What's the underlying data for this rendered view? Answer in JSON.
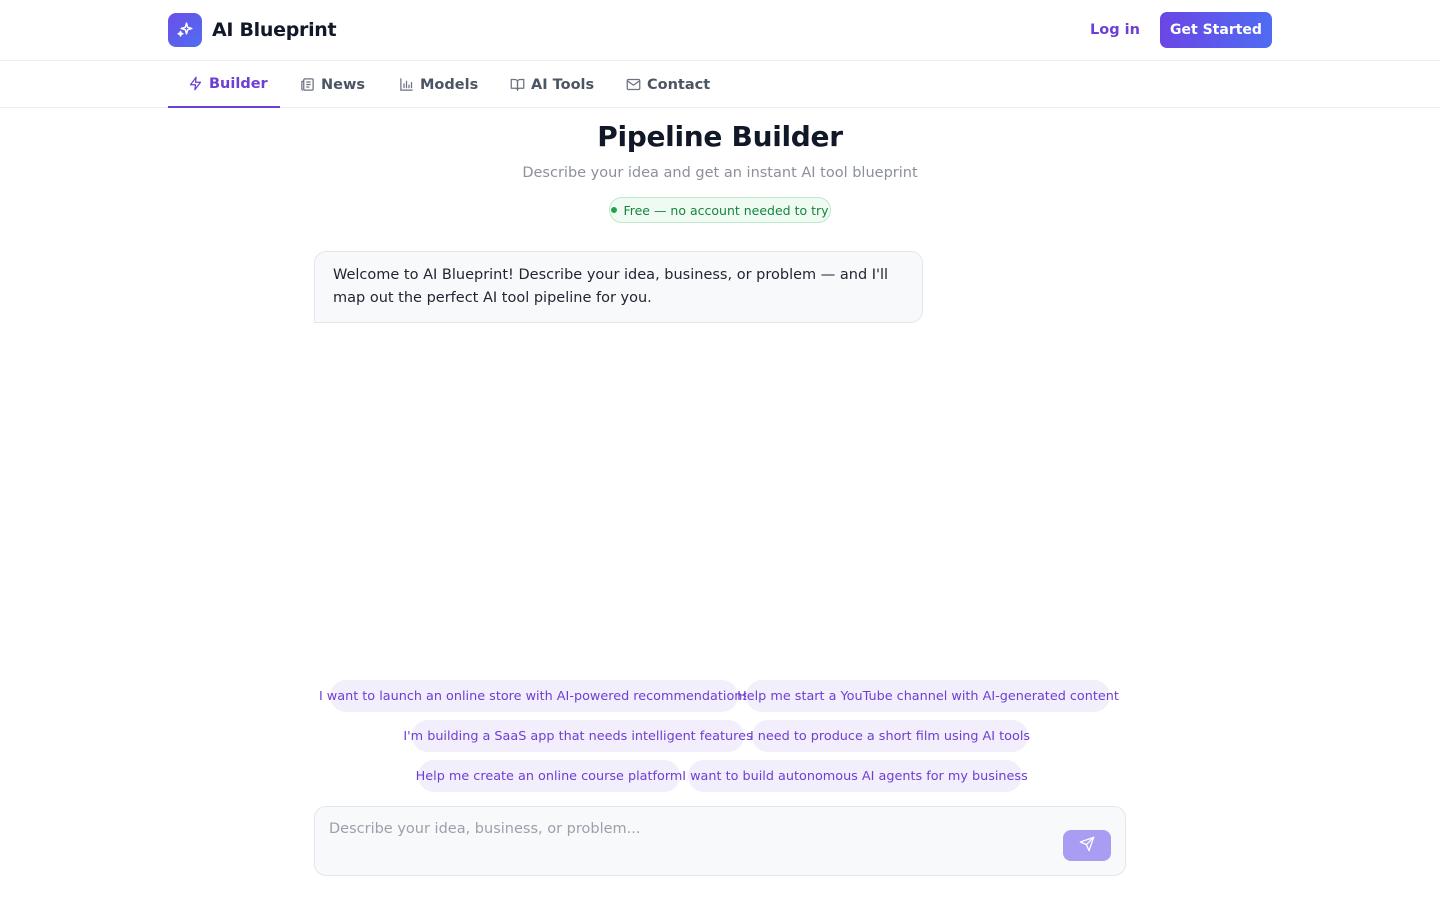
{
  "header": {
    "brand": "AI Blueprint",
    "logo_icon": "sparkles-icon",
    "login_label": "Log in",
    "get_started_label": "Get Started"
  },
  "nav": {
    "tabs": [
      {
        "label": "Builder",
        "icon": "zap-icon",
        "active": true
      },
      {
        "label": "News",
        "icon": "newspaper-icon",
        "active": false
      },
      {
        "label": "Models",
        "icon": "bar-chart-icon",
        "active": false
      },
      {
        "label": "AI Tools",
        "icon": "book-open-icon",
        "active": false
      },
      {
        "label": "Contact",
        "icon": "mail-icon",
        "active": false
      }
    ]
  },
  "hero": {
    "title": "Pipeline Builder",
    "subtitle": "Describe your idea and get an instant AI tool blueprint",
    "badge": "Free — no account needed to try"
  },
  "chat": {
    "welcome_message": "Welcome to AI Blueprint! Describe your idea, business, or problem — and I'll map out the perfect AI tool pipeline for you."
  },
  "suggestions": [
    "I want to launch an online store with AI-powered recommendations",
    "Help me start a YouTube channel with AI-generated content",
    "I'm building a SaaS app that needs intelligent features",
    "I need to produce a short film using AI tools",
    "Help me create an online course platform",
    "I want to build autonomous AI agents for my business"
  ],
  "composer": {
    "value": "",
    "placeholder": "Describe your idea, business, or problem...",
    "send_icon": "send-icon"
  },
  "colors": {
    "accent": "#6d3fd4",
    "accent_gradient_start": "#6b46e5",
    "accent_gradient_end": "#4f6cf2",
    "success": "#16853f"
  }
}
